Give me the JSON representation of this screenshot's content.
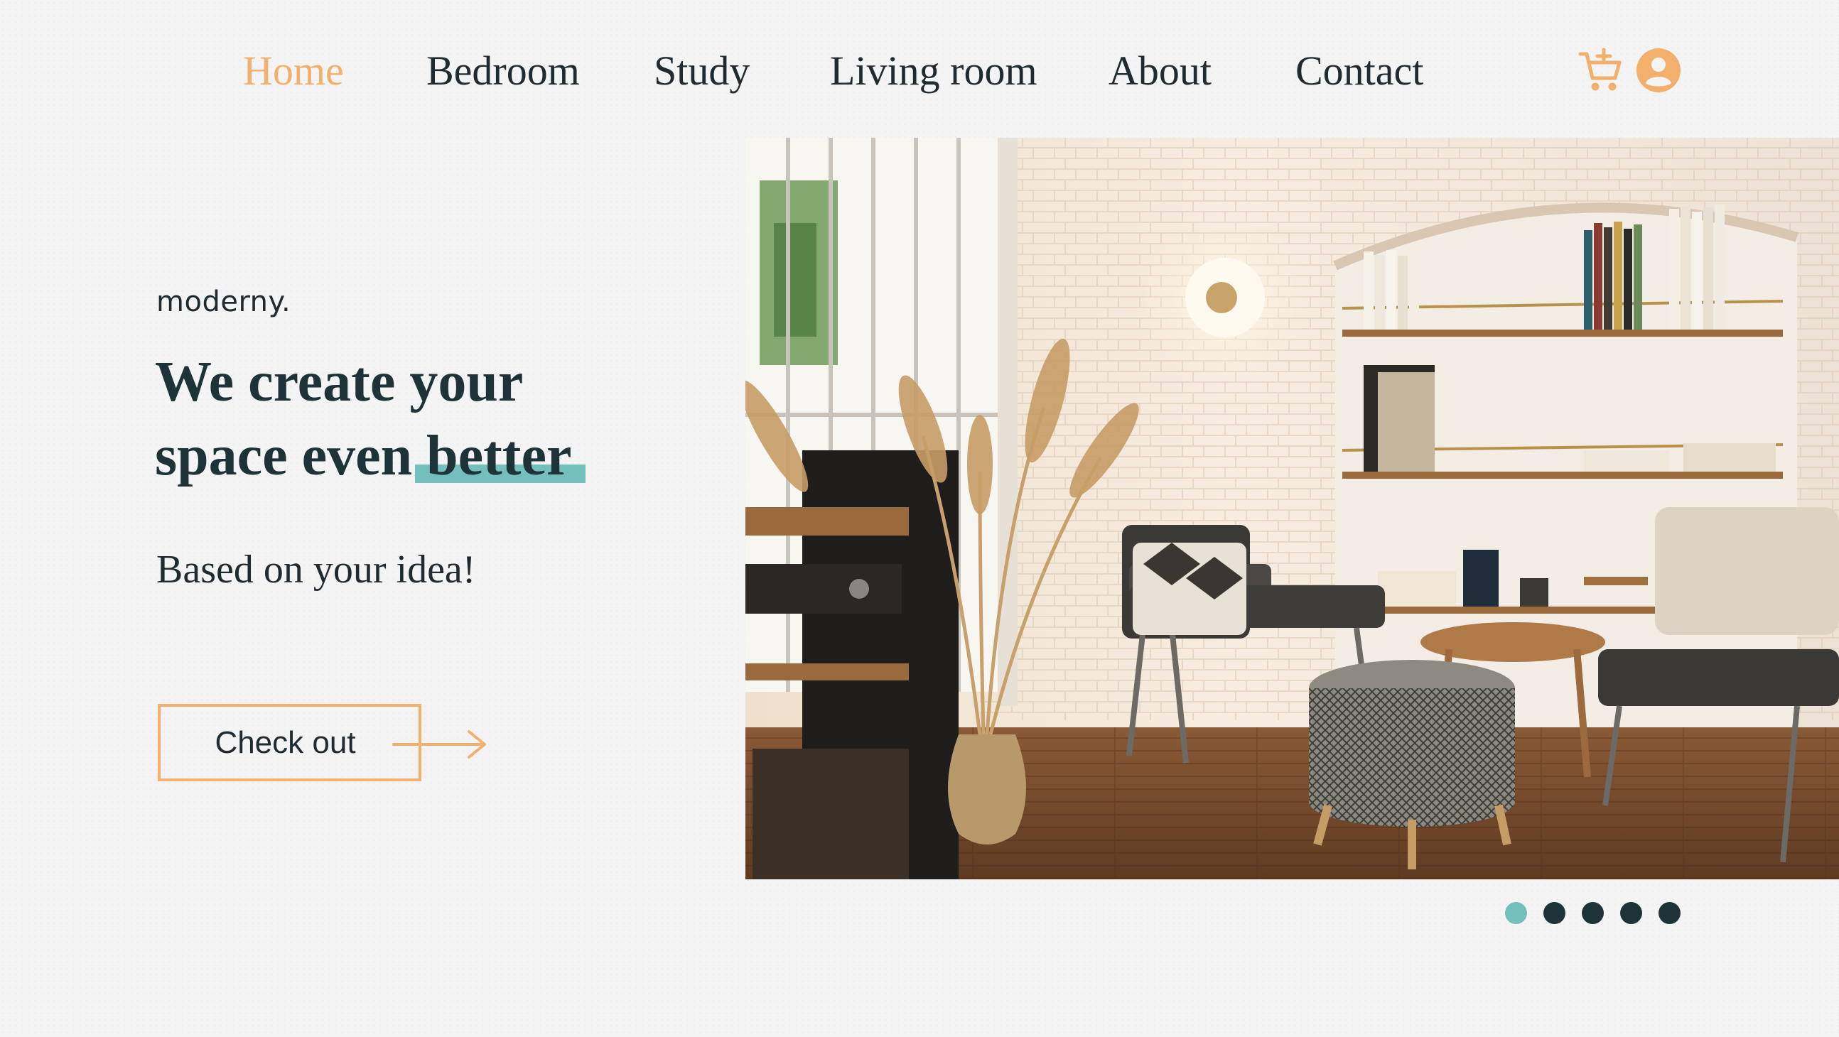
{
  "nav": {
    "items": [
      {
        "label": "Home",
        "active": true
      },
      {
        "label": "Bedroom",
        "active": false
      },
      {
        "label": "Study",
        "active": false
      },
      {
        "label": "Living room",
        "active": false
      },
      {
        "label": "About",
        "active": false
      },
      {
        "label": "Contact",
        "active": false
      }
    ],
    "icons": [
      "add-to-cart-icon",
      "user-account-icon"
    ]
  },
  "hero": {
    "brand": "moderny.",
    "headline_line1": "We create your",
    "headline_line2_prefix": "space even ",
    "headline_highlight": "better",
    "subline": "Based on your idea!",
    "cta_label": "Check out",
    "cta_icon": "arrow-right-icon"
  },
  "carousel": {
    "slide_count": 5,
    "active_index": 0
  },
  "colors": {
    "accent": "#f3b06c",
    "highlight": "#72bfbc",
    "text_dark": "#1d3338",
    "background": "#f4f4f5"
  }
}
